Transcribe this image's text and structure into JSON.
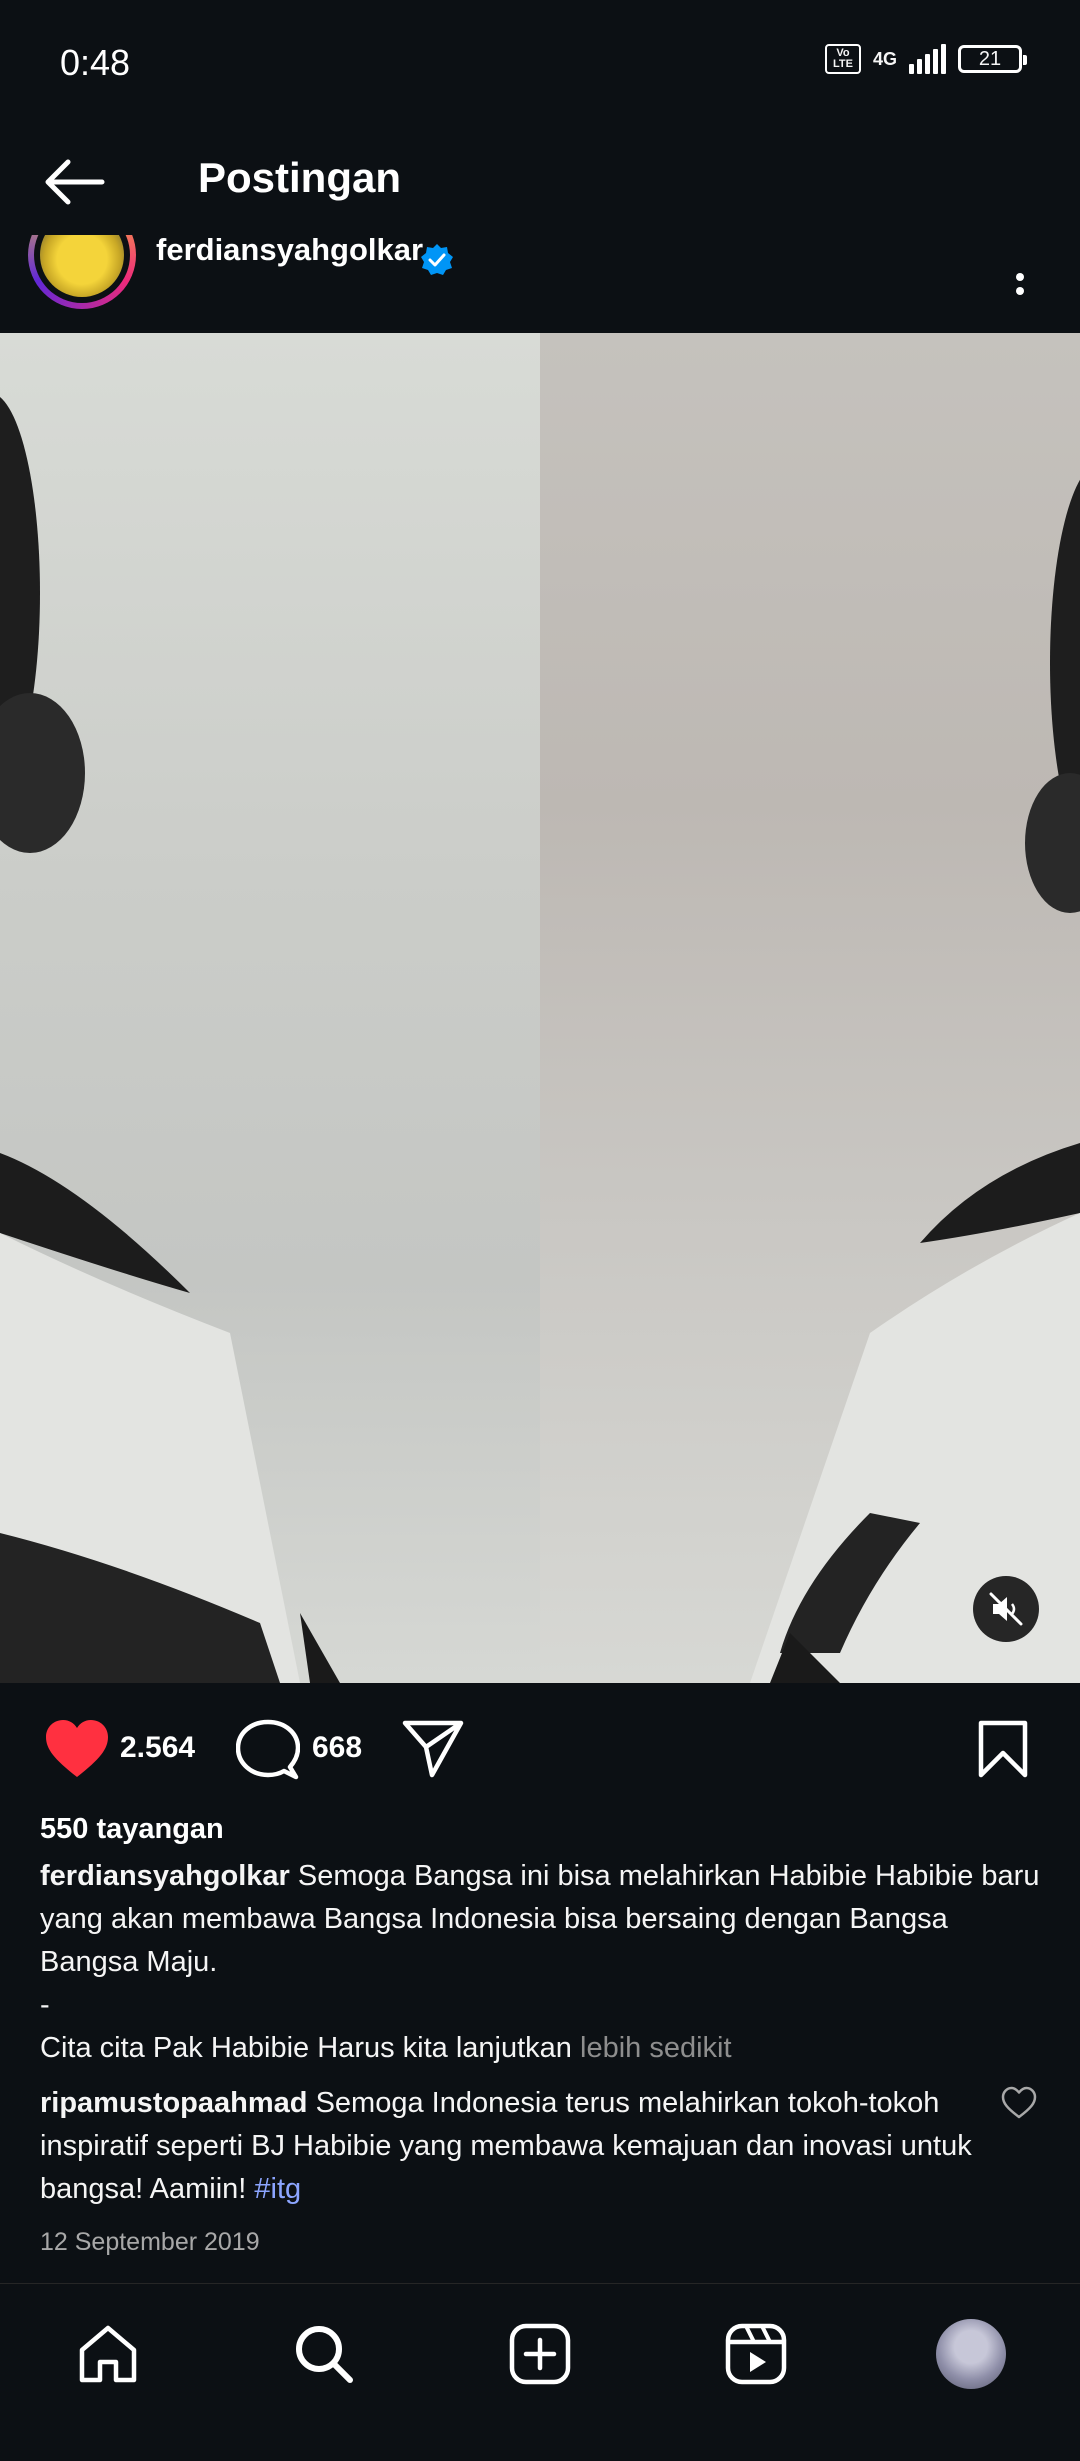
{
  "status_bar": {
    "time": "0:48",
    "volte_top": "Vo",
    "volte_bottom": "LTE",
    "network": "4G",
    "battery": "21"
  },
  "header": {
    "title": "Postingan"
  },
  "post": {
    "username": "ferdiansyahgolkar",
    "verified_color": "#0095f6",
    "likes": "2.564",
    "comments": "668",
    "views": "550 tayangan",
    "caption_text": "Semoga Bangsa ini bisa melahirkan Habibie Habibie baru yang akan membawa Bangsa Indonesia bisa bersaing dengan Bangsa Bangsa Maju.",
    "caption_dash": "-",
    "caption_line2": "Cita cita Pak Habibie Harus kita lanjutkan",
    "more_label": "lebih sedikit",
    "date": "12 September 2019"
  },
  "comment": {
    "username": "ripamustopaahmad",
    "text": "Semoga Indonesia terus melahirkan tokoh-tokoh inspiratif seperti BJ Habibie yang membawa kemajuan dan inovasi untuk bangsa! Aamiin!",
    "hashtag": "#itg"
  },
  "colors": {
    "background": "#0c1014",
    "like_red": "#ff3040",
    "hashtag_blue": "#8ca5ff"
  },
  "icons": {
    "back": "arrow-left-icon",
    "more": "more-vertical-icon",
    "like": "heart-filled-icon",
    "comment": "comment-bubble-icon",
    "share": "paper-plane-icon",
    "save": "bookmark-icon",
    "mute": "speaker-muted-icon",
    "nav": [
      "home-icon",
      "search-icon",
      "create-post-icon",
      "reels-icon",
      "profile-avatar"
    ]
  }
}
